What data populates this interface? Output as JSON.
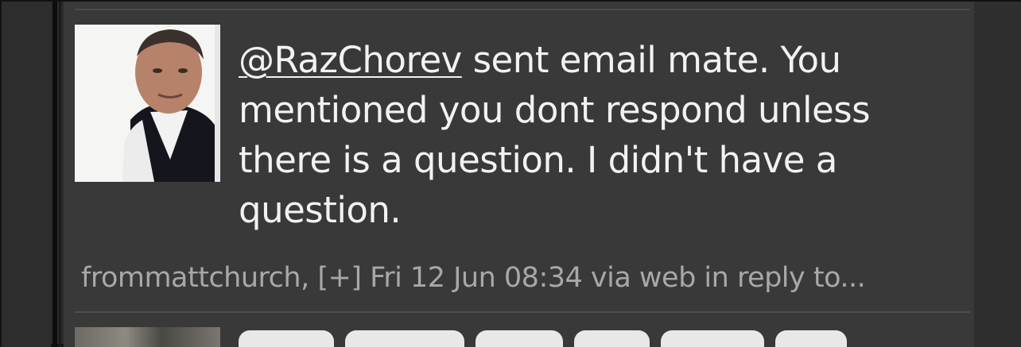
{
  "tweet": {
    "mention": "@RazChorev",
    "body": " sent email mate. You mentioned you dont respond unless there is a question. I didn't have a question.",
    "meta": "frommattchurch, [+] Fri 12 Jun 08:34 via web in reply to..."
  },
  "colors": {
    "background": "#393939",
    "text": "#f2f2f2",
    "meta_text": "#a8a8a8"
  }
}
